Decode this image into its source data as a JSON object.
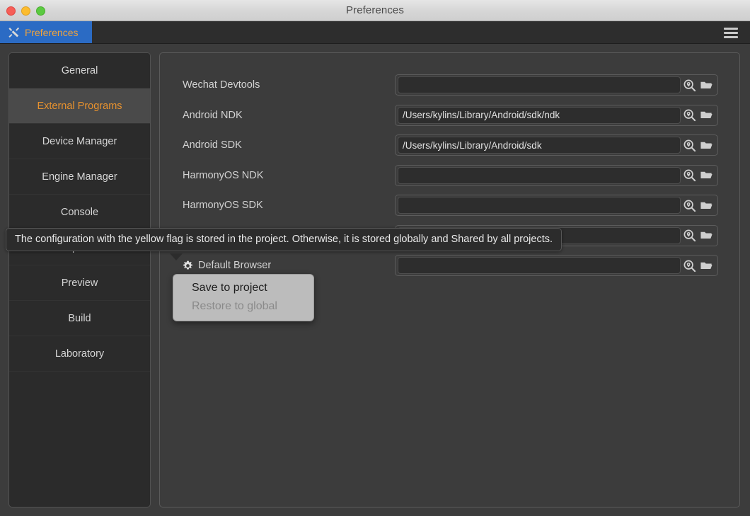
{
  "window": {
    "title": "Preferences",
    "traffic_lights": [
      "close",
      "minimize",
      "maximize"
    ]
  },
  "tabstrip": {
    "tab_label": "Preferences",
    "tab_icon": "tools-icon",
    "menu_icon": "hamburger-menu-icon"
  },
  "sidebar": {
    "items": [
      {
        "label": "General",
        "selected": false
      },
      {
        "label": "External Programs",
        "selected": true
      },
      {
        "label": "Device Manager",
        "selected": false
      },
      {
        "label": "Engine Manager",
        "selected": false
      },
      {
        "label": "Console",
        "selected": false
      },
      {
        "label": "Inspector",
        "selected": false
      },
      {
        "label": "Preview",
        "selected": false
      },
      {
        "label": "Build",
        "selected": false
      },
      {
        "label": "Laboratory",
        "selected": false
      }
    ]
  },
  "main": {
    "rows": [
      {
        "label": "Wechat Devtools",
        "value": "",
        "placeholder": "",
        "gear": false
      },
      {
        "label": "Android NDK",
        "value": "/Users/kylins/Library/Android/sdk/ndk",
        "placeholder": "",
        "gear": false
      },
      {
        "label": "Android SDK",
        "value": "/Users/kylins/Library/Android/sdk",
        "placeholder": "",
        "gear": false
      },
      {
        "label": "HarmonyOS NDK",
        "value": "",
        "placeholder": "",
        "gear": false
      },
      {
        "label": "HarmonyOS SDK",
        "value": "",
        "placeholder": "",
        "gear": false
      },
      {
        "label": "",
        "value": "",
        "placeholder": "",
        "gear": false
      },
      {
        "label": "Default Browser",
        "value": "",
        "placeholder": "",
        "gear": true
      }
    ],
    "search_icon": "locate-search-icon",
    "folder_icon": "open-folder-icon"
  },
  "tooltip": {
    "text": "The configuration with the yellow flag is stored in the project. Otherwise, it is stored globally and Shared by all projects."
  },
  "context_menu": {
    "items": [
      {
        "label": "Save to project",
        "disabled": false
      },
      {
        "label": "Restore to global",
        "disabled": true
      }
    ]
  },
  "colors": {
    "accent_orange": "#e8922e",
    "tab_blue": "#2b6bc4",
    "window_bg": "#3c3c3c",
    "panel_bg": "#2b2b2b",
    "selected_bg": "#4a4a4a"
  }
}
